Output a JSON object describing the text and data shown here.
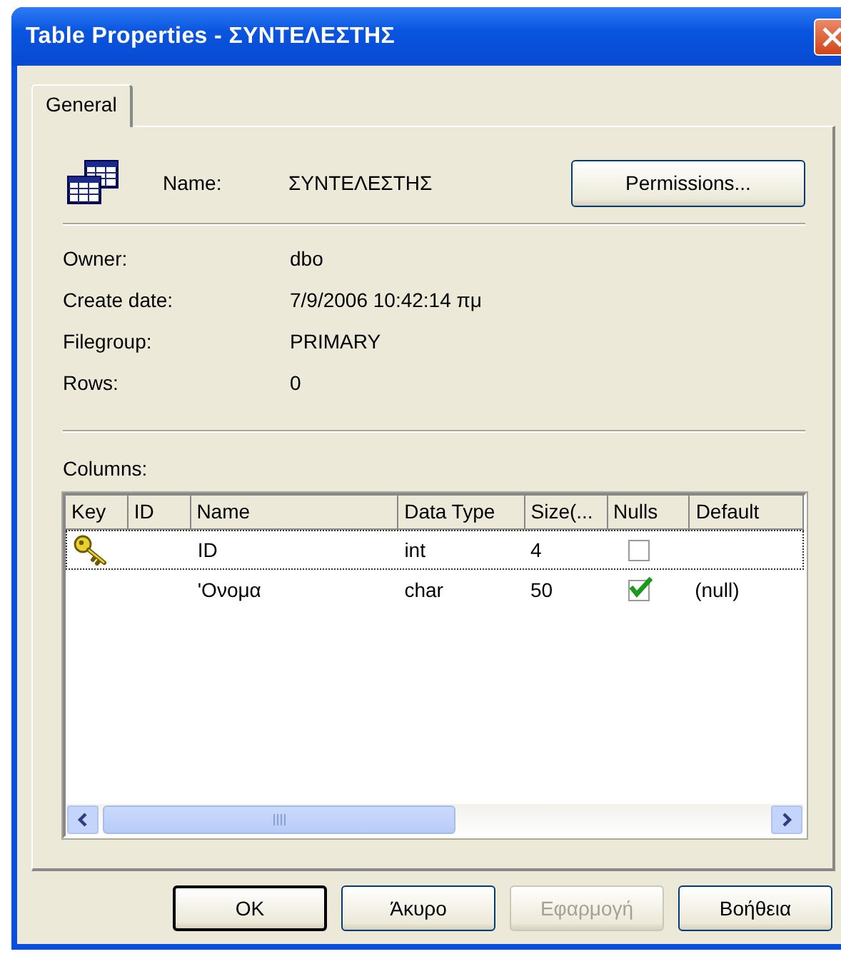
{
  "window": {
    "title": "Table Properties - ΣΥΝΤΕΛΕΣΤΗΣ"
  },
  "tabs": [
    {
      "label": "General",
      "selected": true
    }
  ],
  "name_row": {
    "label": "Name:",
    "value": "ΣΥΝΤΕΛΕΣΤΗΣ",
    "button": "Permissions..."
  },
  "properties": [
    {
      "label": "Owner:",
      "value": "dbo"
    },
    {
      "label": "Create date:",
      "value": "7/9/2006 10:42:14 πμ"
    },
    {
      "label": "Filegroup:",
      "value": "PRIMARY"
    },
    {
      "label": "Rows:",
      "value": "0"
    }
  ],
  "columns_label": "Columns:",
  "grid": {
    "columns": [
      "Key",
      "ID",
      "Name",
      "Data Type",
      "Size(...",
      "Nulls",
      "Default"
    ],
    "rows": [
      {
        "primary_key": true,
        "name": "ID",
        "data_type": "int",
        "size": "4",
        "nulls": false,
        "selected": true
      },
      {
        "primary_key": false,
        "name": "'Ονομα",
        "data_type": "char",
        "size": "50",
        "nulls": true,
        "default": "(null)",
        "selected": false
      }
    ]
  },
  "buttons": [
    {
      "label": "OK",
      "default": true,
      "disabled": false
    },
    {
      "label": "Άκυρο",
      "default": false,
      "disabled": false
    },
    {
      "label": "Εφαρμογή",
      "default": false,
      "disabled": true
    },
    {
      "label": "Βοήθεια",
      "default": false,
      "disabled": false
    }
  ]
}
